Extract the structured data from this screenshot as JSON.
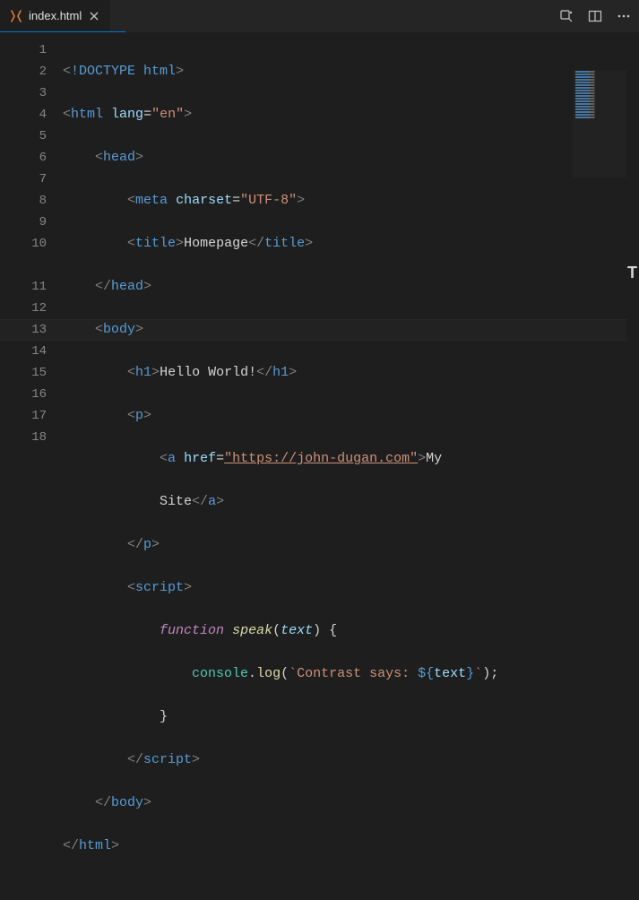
{
  "tab": {
    "label": "index.html"
  },
  "lines": {
    "l1": {
      "n": "1"
    },
    "l2": {
      "n": "2",
      "attr": "lang",
      "val": "\"en\""
    },
    "l3": {
      "n": "3"
    },
    "l4": {
      "n": "4",
      "attr": "charset",
      "val": "\"UTF-8\""
    },
    "l5": {
      "n": "5",
      "text": "Homepage"
    },
    "l6": {
      "n": "6"
    },
    "l7": {
      "n": "7"
    },
    "l8": {
      "n": "8",
      "text": "Hello World!"
    },
    "l9": {
      "n": "9"
    },
    "l10": {
      "n": "10",
      "attr": "href",
      "url": "\"https://john-dugan.com\"",
      "text1": "My",
      "text2": "Site"
    },
    "l11": {
      "n": "11"
    },
    "l12": {
      "n": "12"
    },
    "l13": {
      "n": "13",
      "kw": "function",
      "fn": "speak",
      "param": "text"
    },
    "l14": {
      "n": "14",
      "obj": "console",
      "method": "log",
      "str1": "`Contrast says: ",
      "tvar1": "${",
      "tid": "text",
      "tvar2": "}",
      "str2": "`"
    },
    "l15": {
      "n": "15"
    },
    "l16": {
      "n": "16"
    },
    "l17": {
      "n": "17"
    },
    "l18": {
      "n": "18"
    }
  },
  "tags": {
    "doctype": "!DOCTYPE",
    "html": "html",
    "head": "head",
    "meta": "meta",
    "title": "title",
    "body": "body",
    "h1": "h1",
    "p": "p",
    "a": "a",
    "script": "script"
  }
}
